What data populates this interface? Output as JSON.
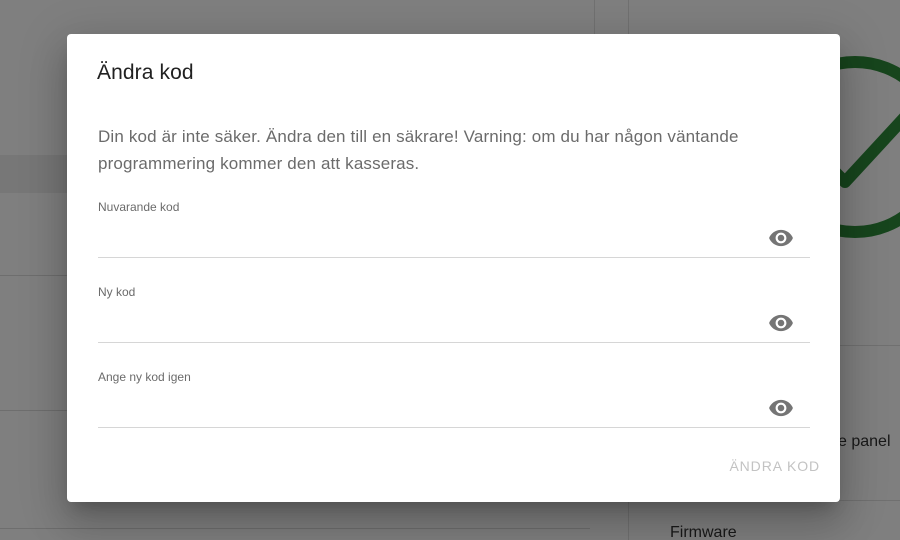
{
  "dialog": {
    "title": "Ändra kod",
    "message": "Din kod är inte säker. Ändra den till en säkrare! Varning: om du har någon väntande programmering kommer den att kasseras.",
    "fields": [
      {
        "label": "Nuvarande kod",
        "value": "",
        "icon": "eye-icon"
      },
      {
        "label": "Ny kod",
        "value": "",
        "icon": "eye-icon"
      },
      {
        "label": "Ange ny kod igen",
        "value": "",
        "icon": "eye-icon"
      }
    ],
    "submit_label": "ÄNDRA KOD",
    "submit_enabled": false
  },
  "background": {
    "panel_text": "e panel",
    "firmware_text": "Firmware",
    "status_icon": "checkmark-circle-icon",
    "status_color": "#2e8b3a"
  },
  "colors": {
    "overlay": "rgba(0,0,0,0.5)",
    "dialog_bg": "#ffffff",
    "disabled_text": "#c3c3c3"
  }
}
